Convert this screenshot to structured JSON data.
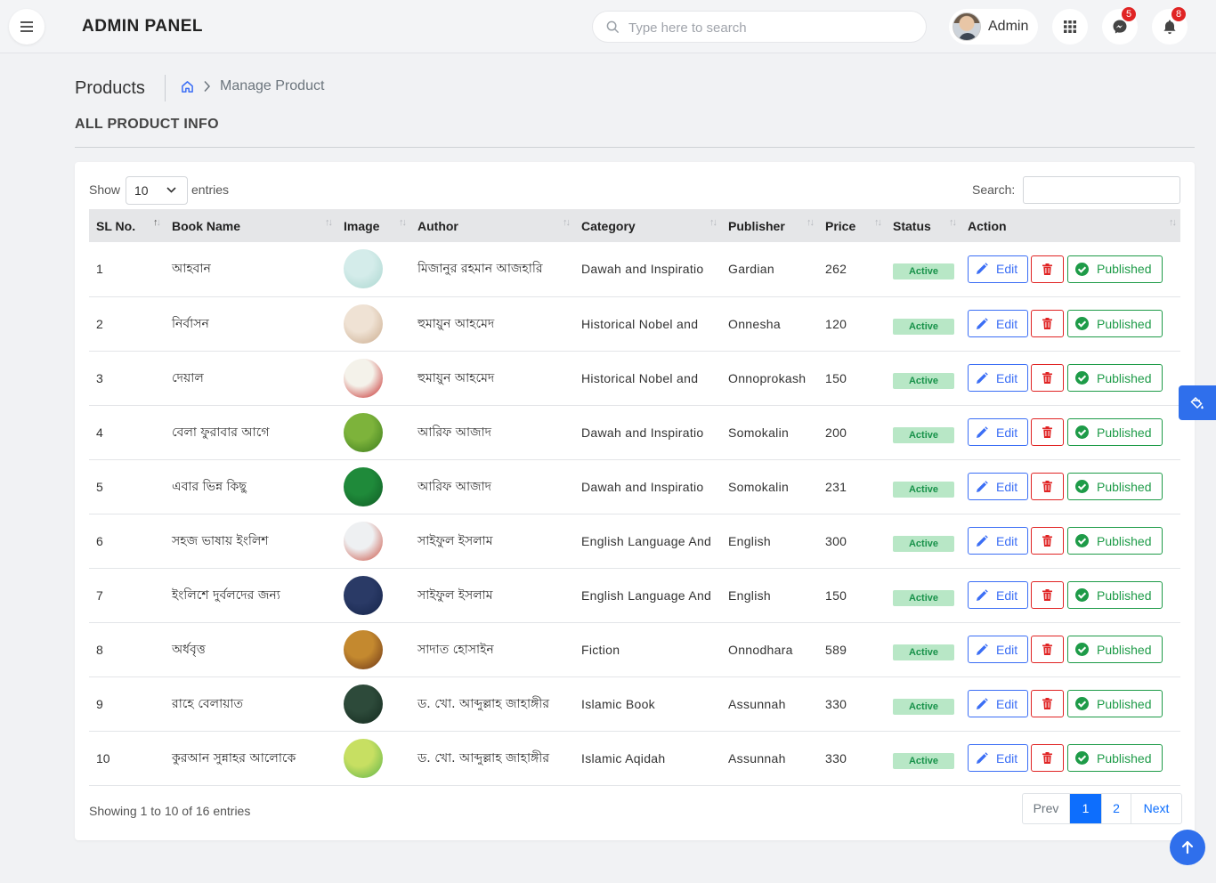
{
  "header": {
    "brand": "ADMIN PANEL",
    "search_placeholder": "Type here to search",
    "user_name": "Admin",
    "messages_count": "5",
    "notifications_count": "8"
  },
  "page": {
    "title": "Products",
    "breadcrumb_current": "Manage Product",
    "section_title": "ALL PRODUCT INFO"
  },
  "table_controls": {
    "show_label": "Show",
    "page_length": "10",
    "entries_label": "entries",
    "search_label": "Search:"
  },
  "columns": [
    "SL No.",
    "Book Name",
    "Image",
    "Author",
    "Category",
    "Publisher",
    "Price",
    "Status",
    "Action"
  ],
  "labels": {
    "status": "Active",
    "edit": "Edit",
    "published": "Published"
  },
  "rows": [
    {
      "sl": "1",
      "name": "আহবান",
      "author": "মিজানুর রহমান আজহারি",
      "category": "Dawah and Inspiratio",
      "publisher": "Gardian",
      "price": "262"
    },
    {
      "sl": "2",
      "name": "নির্বাসন",
      "author": "হুমায়ুন আহমেদ",
      "category": "Historical Nobel and",
      "publisher": "Onnesha",
      "price": "120"
    },
    {
      "sl": "3",
      "name": "দেয়াল",
      "author": "হুমায়ুন আহমেদ",
      "category": "Historical Nobel and",
      "publisher": "Onnoprokash",
      "price": "150"
    },
    {
      "sl": "4",
      "name": "বেলা ফুরাবার আগে",
      "author": "আরিফ আজাদ",
      "category": "Dawah and Inspiratio",
      "publisher": "Somokalin",
      "price": "200"
    },
    {
      "sl": "5",
      "name": "এবার ভিন্ন কিছু",
      "author": "আরিফ আজাদ",
      "category": "Dawah and Inspiratio",
      "publisher": "Somokalin",
      "price": "231"
    },
    {
      "sl": "6",
      "name": "সহজ ভাষায় ইংলিশ",
      "author": "সাইফুল ইসলাম",
      "category": "English Language And",
      "publisher": "English",
      "price": "300"
    },
    {
      "sl": "7",
      "name": "ইংলিশে দুর্বলদের জন্য",
      "author": "সাইফুল ইসলাম",
      "category": "English Language And",
      "publisher": "English",
      "price": "150"
    },
    {
      "sl": "8",
      "name": "অর্ধবৃত্ত",
      "author": "সাদাত হোসাইন",
      "category": "Fiction",
      "publisher": "Onnodhara",
      "price": "589"
    },
    {
      "sl": "9",
      "name": "রাহে বেলায়াত",
      "author": "ড. খো. আব্দুল্লাহ জাহাঙ্গীর",
      "category": "Islamic Book",
      "publisher": "Assunnah",
      "price": "330"
    },
    {
      "sl": "10",
      "name": "কুরআন সুন্নাহর আলোকে",
      "author": "ড. খো. আব্দুল্লাহ জাহাঙ্গীর",
      "category": "Islamic Aqidah",
      "publisher": "Assunnah",
      "price": "330"
    }
  ],
  "thumb_colors": [
    [
      "#d4ecea",
      "#a9d6cf"
    ],
    [
      "#efe2d4",
      "#c9a98a"
    ],
    [
      "#f4f2ea",
      "#c42020"
    ],
    [
      "#7db33b",
      "#3a7a1c"
    ],
    [
      "#1f8a3a",
      "#0f5a24"
    ],
    [
      "#eef0f2",
      "#c94a3a"
    ],
    [
      "#2a3a66",
      "#15244a"
    ],
    [
      "#c4892f",
      "#6a3316"
    ],
    [
      "#2d4a3a",
      "#142a1e"
    ],
    [
      "#c7df62",
      "#5bb24a"
    ]
  ],
  "footer": {
    "info": "Showing 1 to 10 of 16 entries",
    "prev": "Prev",
    "page1": "1",
    "page2": "2",
    "next": "Next"
  }
}
